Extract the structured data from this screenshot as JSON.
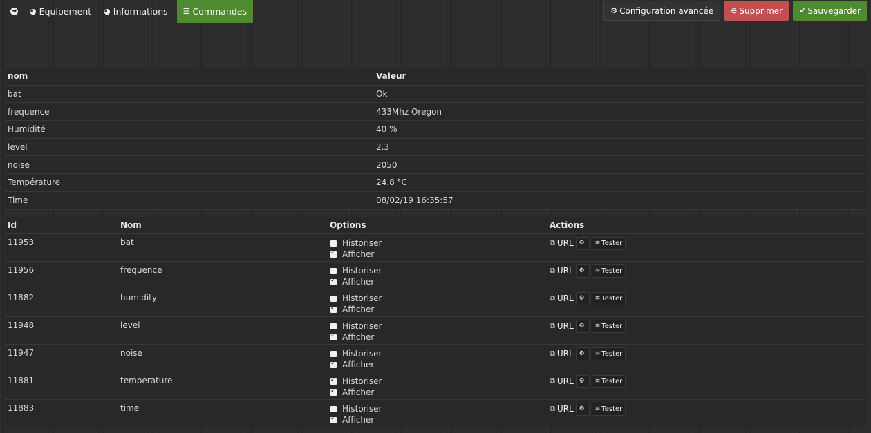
{
  "tabs": {
    "back_icon": "arrow-left-icon",
    "equipement": "Equipement",
    "informations": "Informations",
    "commandes": "Commandes"
  },
  "buttons": {
    "configuration": "Configuration avancée",
    "supprimer": "Supprimer",
    "sauvegarder": "Sauvegarder"
  },
  "colors": {
    "accent_green": "#4e8a2f",
    "danger_red": "#c0504d"
  },
  "info_table": {
    "headers": [
      "nom",
      "Valeur"
    ],
    "rows": [
      [
        "bat",
        "Ok"
      ],
      [
        "frequence",
        "433Mhz Oregon"
      ],
      [
        "Humidité",
        "40 %"
      ],
      [
        "level",
        "2.3"
      ],
      [
        "noise",
        "2050"
      ],
      [
        "Température",
        "24.8 °C"
      ],
      [
        "Time",
        "08/02/19 16:35:57"
      ]
    ]
  },
  "cmd_table": {
    "headers": [
      "Id",
      "Nom",
      "Options",
      "Actions"
    ],
    "option_labels": [
      "Historiser",
      "Afficher"
    ],
    "url_label": "URL",
    "tester_label": "Tester",
    "rows": [
      {
        "id": "11953",
        "nom": "bat",
        "historiser": false,
        "afficher": true
      },
      {
        "id": "11956",
        "nom": "frequence",
        "historiser": false,
        "afficher": true
      },
      {
        "id": "11882",
        "nom": "humidity",
        "historiser": false,
        "afficher": true
      },
      {
        "id": "11948",
        "nom": "level",
        "historiser": false,
        "afficher": true
      },
      {
        "id": "11947",
        "nom": "noise",
        "historiser": false,
        "afficher": true
      },
      {
        "id": "11881",
        "nom": "temperature",
        "historiser": true,
        "afficher": true
      },
      {
        "id": "11883",
        "nom": "time",
        "historiser": false,
        "afficher": true
      }
    ]
  }
}
